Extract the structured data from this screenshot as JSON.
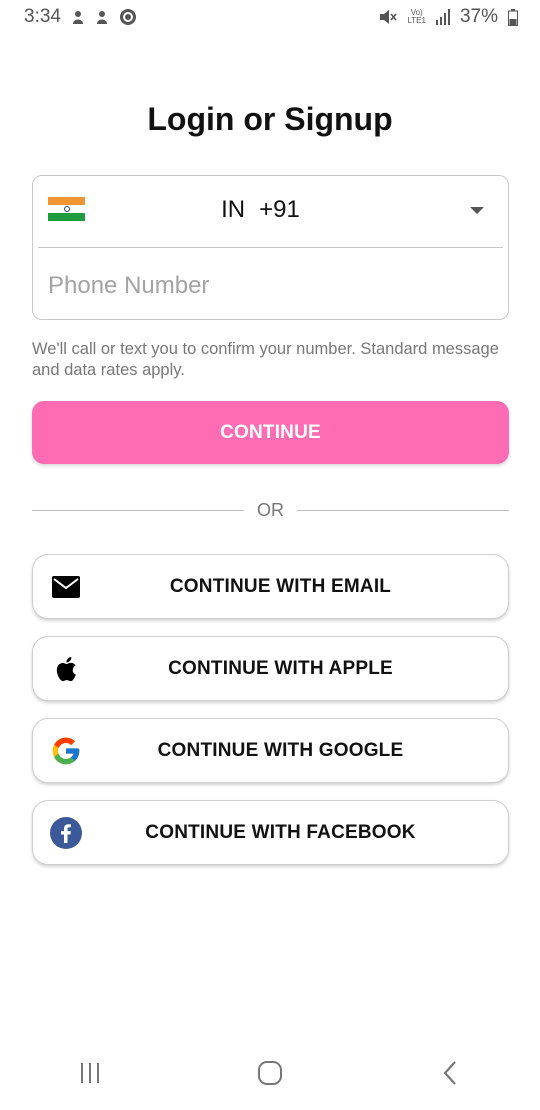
{
  "status_bar": {
    "time": "3:34",
    "battery": "37%",
    "lte_top": "Vo)",
    "lte_bottom": "LTE1"
  },
  "title": "Login or Signup",
  "phone": {
    "country_code": "IN",
    "dial_code": "+91",
    "placeholder": "Phone Number",
    "value": ""
  },
  "helper_text": "We'll call or text you to confirm your number. Standard message and data rates apply.",
  "continue_label": "CONTINUE",
  "or_label": "OR",
  "social": {
    "email": "CONTINUE WITH EMAIL",
    "apple": "CONTINUE WITH APPLE",
    "google": "CONTINUE WITH GOOGLE",
    "facebook": "CONTINUE WITH FACEBOOK"
  },
  "colors": {
    "accent": "#ff6cb3",
    "facebook": "#3b5998"
  },
  "icons": {
    "flag": "india-flag-icon",
    "email": "envelope-icon",
    "apple": "apple-icon",
    "google": "google-icon",
    "facebook": "facebook-icon",
    "nav_recents": "recents-icon",
    "nav_home": "home-icon",
    "nav_back": "back-icon"
  }
}
